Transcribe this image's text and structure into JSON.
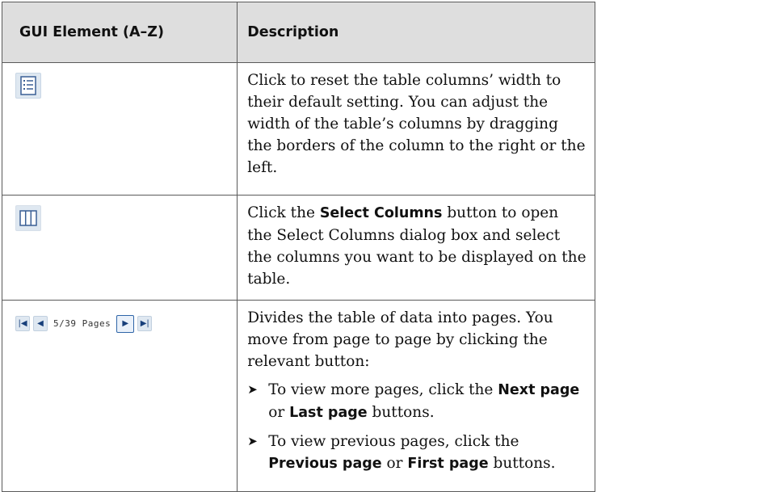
{
  "header": {
    "col1": "GUI Element (A–Z)",
    "col2": "Description"
  },
  "rows": [
    {
      "icon": "reset-columns-width-icon",
      "description": "Click to reset the table columns’ width to their default setting. You can adjust the width of the table’s columns by dragging the borders of the column to the right or the left."
    },
    {
      "icon": "select-columns-icon",
      "desc_pre": "Click the ",
      "desc_bold": "Select Columns",
      "desc_post": " button to open the Select Columns dialog box and select the columns you want to be displayed on the table."
    },
    {
      "pager_text": "5/39 Pages",
      "description": "Divides the table of data into pages. You move from page to page by clicking the relevant button:",
      "bullets": [
        {
          "pre": "To view more pages, click the ",
          "b1": "Next page",
          "mid": " or ",
          "b2": "Last page",
          "post": " buttons."
        },
        {
          "pre": "To view previous pages, click the ",
          "b1": "Previous page",
          "mid": " or ",
          "b2": "First page",
          "post": " buttons."
        }
      ]
    }
  ]
}
